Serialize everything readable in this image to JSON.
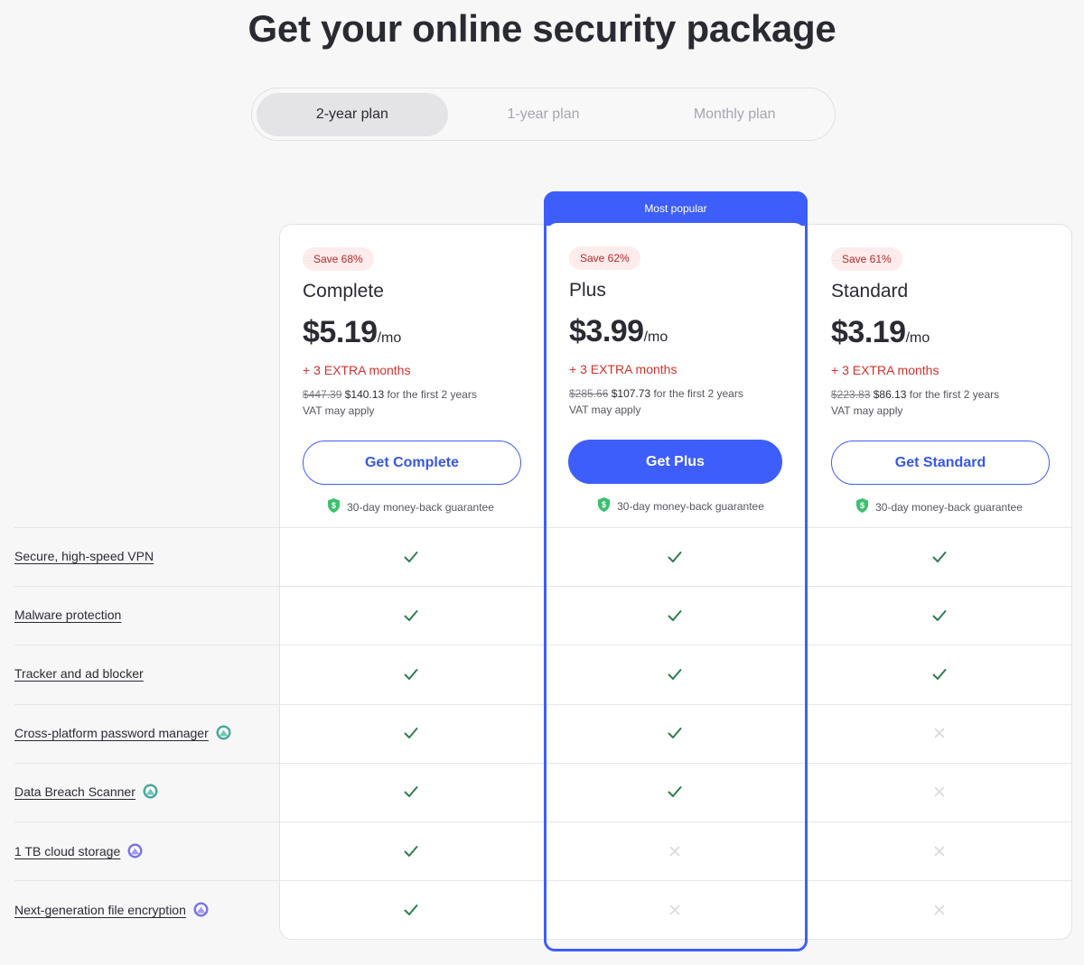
{
  "header": {
    "title": "Get your online security package"
  },
  "plan_toggle": {
    "options": [
      {
        "label": "2-year plan",
        "active": true
      },
      {
        "label": "1-year plan",
        "active": false
      },
      {
        "label": "Monthly plan",
        "active": false
      }
    ]
  },
  "popular_label": "Most popular",
  "colors": {
    "accent": "#3e5efc",
    "check": "#2e7d4f",
    "cross": "#d9d9dc",
    "extra": "#d4312b",
    "badge_bg": "#fdeceb"
  },
  "plans": [
    {
      "badge": "Save 68%",
      "name": "Complete",
      "price": "$5.19",
      "per": "/mo",
      "extra": "+ 3 EXTRA months",
      "old_price": "$447.39",
      "new_price": "$140.13",
      "period": "for the first 2 years",
      "vat": "VAT may apply",
      "cta": "Get Complete",
      "guarantee": "30-day money-back guarantee"
    },
    {
      "badge": "Save 62%",
      "name": "Plus",
      "price": "$3.99",
      "per": "/mo",
      "extra": "+ 3 EXTRA months",
      "old_price": "$285.66",
      "new_price": "$107.73",
      "period": "for the first 2 years",
      "vat": "VAT may apply",
      "cta": "Get Plus",
      "guarantee": "30-day money-back guarantee"
    },
    {
      "badge": "Save 61%",
      "name": "Standard",
      "price": "$3.19",
      "per": "/mo",
      "extra": "+ 3 EXTRA months",
      "old_price": "$223.83",
      "new_price": "$86.13",
      "period": "for the first 2 years",
      "vat": "VAT may apply",
      "cta": "Get Standard",
      "guarantee": "30-day money-back guarantee"
    }
  ],
  "features": [
    {
      "label": "Secure, high-speed VPN",
      "icon": "none",
      "included": [
        true,
        true,
        true
      ]
    },
    {
      "label": "Malware protection",
      "icon": "none",
      "included": [
        true,
        true,
        true
      ]
    },
    {
      "label": "Tracker and ad blocker",
      "icon": "none",
      "included": [
        true,
        true,
        true
      ]
    },
    {
      "label": "Cross-platform password manager",
      "icon": "nordpass-icon",
      "included": [
        true,
        true,
        false
      ]
    },
    {
      "label": "Data Breach Scanner",
      "icon": "nordpass-icon",
      "included": [
        true,
        true,
        false
      ]
    },
    {
      "label": "1 TB cloud storage",
      "icon": "nordlocker-icon",
      "included": [
        true,
        false,
        false
      ]
    },
    {
      "label": "Next-generation file encryption",
      "icon": "nordlocker-icon",
      "included": [
        true,
        false,
        false
      ]
    }
  ]
}
